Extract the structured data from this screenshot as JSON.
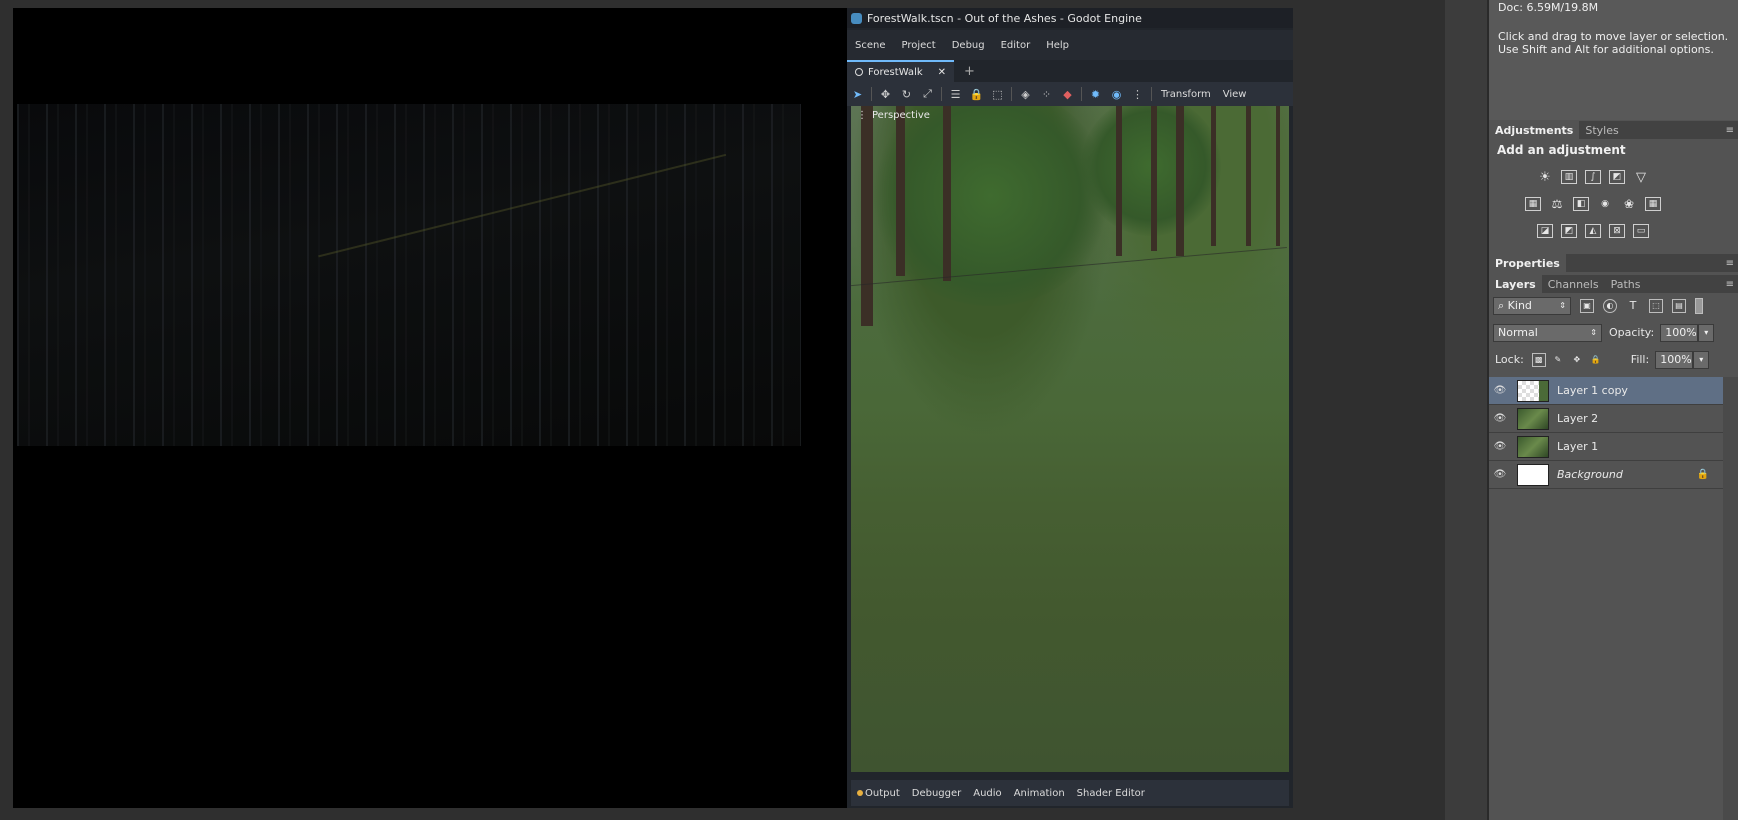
{
  "godot": {
    "title": "ForestWalk.tscn - Out of the Ashes - Godot Engine",
    "menu": [
      "Scene",
      "Project",
      "Debug",
      "Editor",
      "Help"
    ],
    "tab": {
      "label": "ForestWalk",
      "close": "✕",
      "add": "+"
    },
    "toolbar": {
      "transform_label": "Transform",
      "view_label": "View"
    },
    "viewport_label": "Perspective",
    "bottom_tabs": [
      "Output",
      "Debugger",
      "Audio",
      "Animation",
      "Shader Editor"
    ]
  },
  "photoshop": {
    "info": {
      "doc": "Doc: 6.59M/19.8M",
      "help": "Click and drag to move layer or selection. Use Shift and Alt for additional options."
    },
    "adjustments_tabs": [
      "Adjustments",
      "Styles"
    ],
    "adjustments_title": "Add an adjustment",
    "properties_tab": "Properties",
    "layers_tabs": [
      "Layers",
      "Channels",
      "Paths"
    ],
    "filter_kind": "Kind",
    "blend_mode": "Normal",
    "opacity_label": "Opacity:",
    "opacity_value": "100%",
    "lock_label": "Lock:",
    "fill_label": "Fill:",
    "fill_value": "100%",
    "layers": [
      {
        "name": "Layer 1 copy",
        "selected": true
      },
      {
        "name": "Layer 2",
        "selected": false
      },
      {
        "name": "Layer 1",
        "selected": false
      },
      {
        "name": "Background",
        "selected": false,
        "locked": true
      }
    ]
  },
  "colors": {
    "godot_accent": "#70bafa",
    "ps_selection": "#5f6f85",
    "panel_bg": "#535353"
  }
}
